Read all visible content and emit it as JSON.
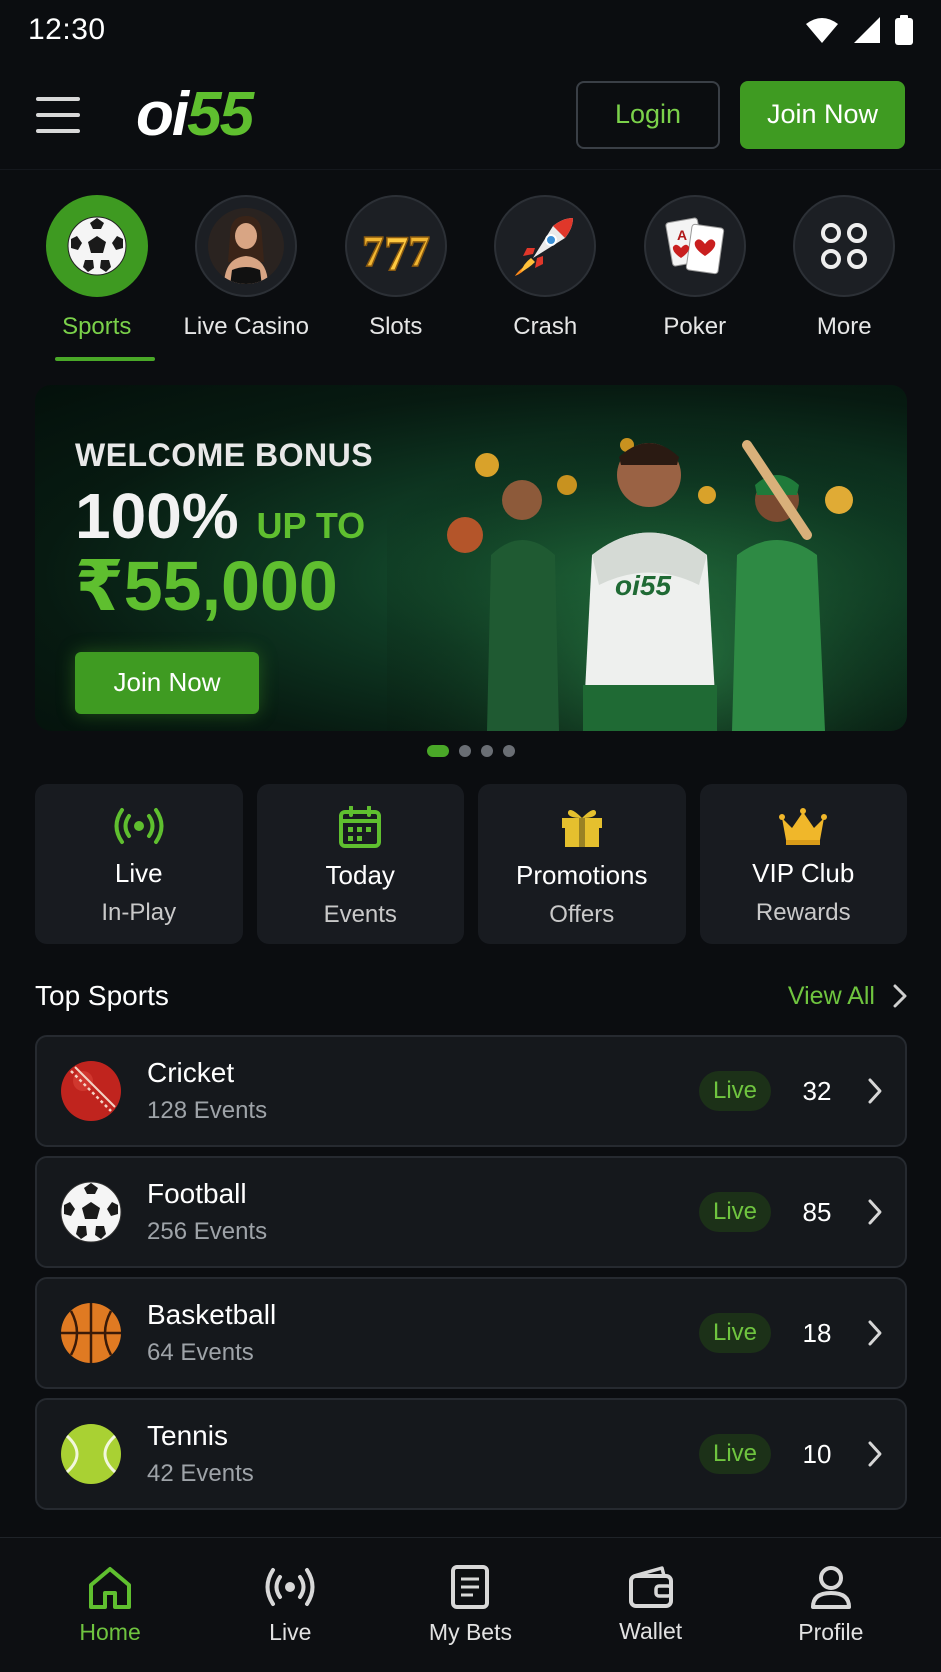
{
  "status_bar": {
    "time": "12:30"
  },
  "header": {
    "logo_white": "oi",
    "logo_green": "55",
    "login_label": "Login",
    "join_label": "Join Now"
  },
  "categories": [
    {
      "label": "Sports",
      "icon": "soccer-ball-icon",
      "active": true
    },
    {
      "label": "Live Casino",
      "icon": "live-dealer-icon",
      "active": false
    },
    {
      "label": "Slots",
      "icon": "slots-777-icon",
      "active": false
    },
    {
      "label": "Crash",
      "icon": "rocket-icon",
      "active": false
    },
    {
      "label": "Poker",
      "icon": "playing-cards-icon",
      "active": false
    },
    {
      "label": "More",
      "icon": "grid-dots-icon",
      "active": false
    }
  ],
  "banner": {
    "title": "WELCOME BONUS",
    "percent": "100%",
    "up_to": "UP TO",
    "amount": "₹55,000",
    "button_label": "Join Now",
    "jersey_text": "oi55",
    "slides": 4,
    "active_slide": 1
  },
  "tiles": [
    {
      "line1": "Live",
      "line2": "In-Play",
      "icon": "broadcast-icon"
    },
    {
      "line1": "Today",
      "line2": "Events",
      "icon": "calendar-icon"
    },
    {
      "line1": "Promotions",
      "line2": "Offers",
      "icon": "gift-icon"
    },
    {
      "line1": "VIP Club",
      "line2": "Rewards",
      "icon": "crown-icon"
    }
  ],
  "top_sports": {
    "title": "Top Sports",
    "view_all": "View All",
    "items": [
      {
        "name": "Cricket",
        "events": "128 Events",
        "live": "Live",
        "count": "32",
        "icon": "cricket-ball-icon"
      },
      {
        "name": "Football",
        "events": "256 Events",
        "live": "Live",
        "count": "85",
        "icon": "football-icon"
      },
      {
        "name": "Basketball",
        "events": "64 Events",
        "live": "Live",
        "count": "18",
        "icon": "basketball-icon"
      },
      {
        "name": "Tennis",
        "events": "42 Events",
        "live": "Live",
        "count": "10",
        "icon": "tennis-ball-icon"
      }
    ]
  },
  "bottom_nav": [
    {
      "label": "Home",
      "icon": "home-icon",
      "active": true
    },
    {
      "label": "Live",
      "icon": "broadcast-icon",
      "active": false
    },
    {
      "label": "My Bets",
      "icon": "bet-slip-icon",
      "active": false
    },
    {
      "label": "Wallet",
      "icon": "wallet-icon",
      "active": false
    },
    {
      "label": "Profile",
      "icon": "profile-icon",
      "active": false
    }
  ],
  "colors": {
    "accent": "#3f9b22",
    "accent_text": "#6fc43f",
    "background": "#0b0d10",
    "card": "#15181c"
  }
}
